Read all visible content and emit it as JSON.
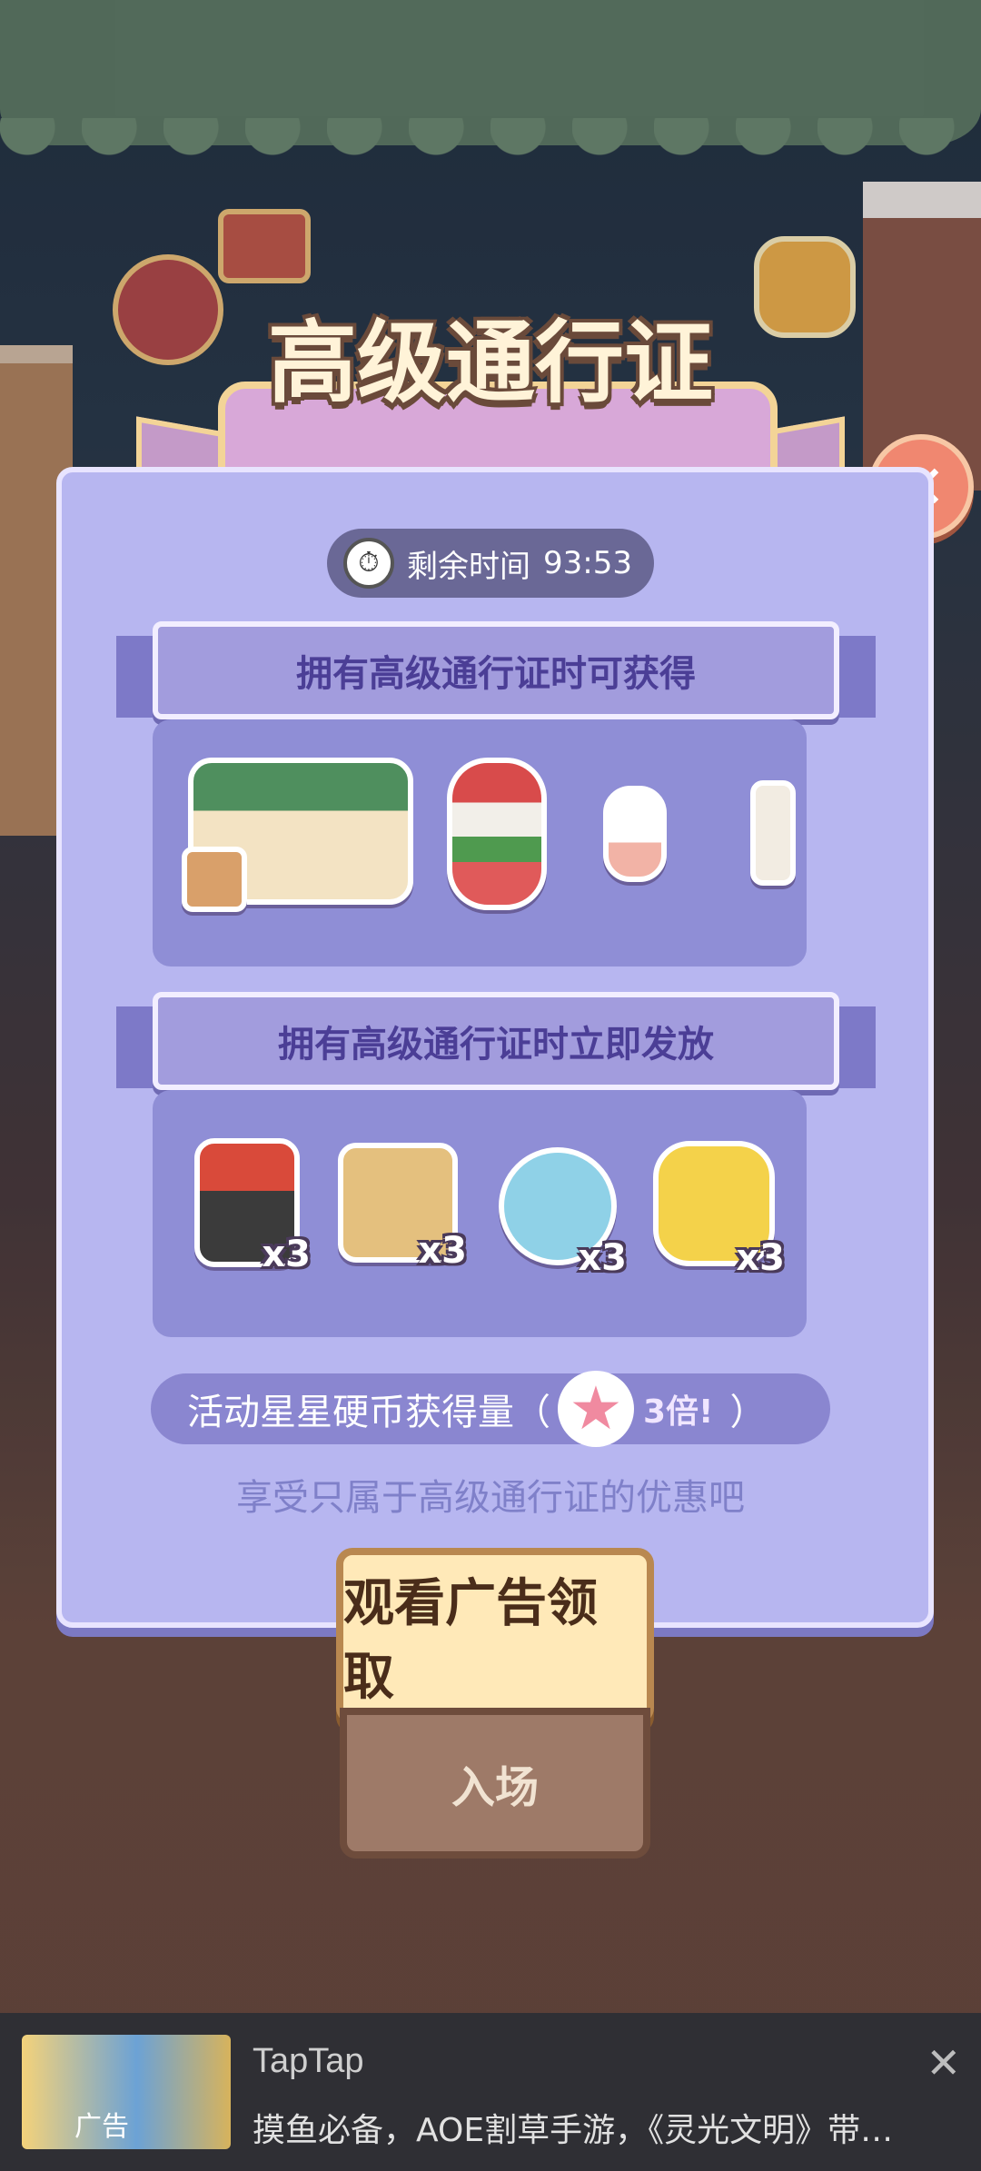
{
  "title": "高级通行证",
  "timer": {
    "label": "剩余时间",
    "value": "93:53"
  },
  "sections": {
    "gain_title": "拥有高级通行证时可获得",
    "instant_title": "拥有高级通行证时立即发放"
  },
  "instant_items": [
    {
      "qty": "x3",
      "icon": "soda-can-icon"
    },
    {
      "qty": "x3",
      "icon": "camera-icon"
    },
    {
      "qty": "x3",
      "icon": "hand-fan-icon"
    },
    {
      "qty": "x3",
      "icon": "cheer-glove-icon"
    }
  ],
  "coin": {
    "text": "活动星星硬币获得量（",
    "multiplier": "3倍!",
    "close": "）"
  },
  "subtitle": "享受只属于高级通行证的优惠吧",
  "buttons": {
    "primary": "观看广告领取",
    "secondary": "入场"
  },
  "ad": {
    "label": "广告",
    "title": "TapTap",
    "description": "摸鱼必备，AOE割草手游，《灵光文明》带…"
  }
}
